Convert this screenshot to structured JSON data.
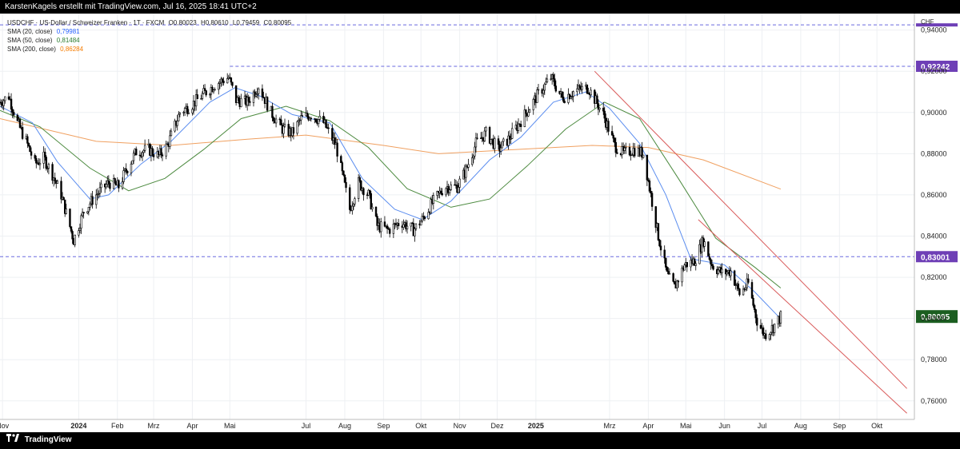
{
  "header": {
    "text": "KarstenKagels erstellt mit TradingView.com, Jul 16, 2025 18:41 UTC+2"
  },
  "footer": {
    "brand": "TradingView"
  },
  "legend": {
    "symbol_line": "USDCHF · US-Dollar / Schweizer Franken · 1T · FXCM",
    "ohlc": [
      "O0,80023",
      "H0,80610",
      "L0,79459",
      "C0,80095"
    ],
    "sma": [
      {
        "label": "SMA (20, close)",
        "value": "0,79981",
        "color": "#2962ff"
      },
      {
        "label": "SMA (50, close)",
        "value": "0,81484",
        "color": "#2e7d32"
      },
      {
        "label": "SMA (200, close)",
        "value": "0,86284",
        "color": "#f57c00"
      }
    ]
  },
  "colors": {
    "up": "#000000",
    "down": "#000000",
    "up_fill": "#ffffff",
    "sma20": "#5b8def",
    "sma50": "#4c8a3f",
    "sma200": "#f0a060",
    "trend": "#d95a5a",
    "hline": "#6a6adf",
    "label_purple": "#6e3fb6",
    "label_green": "#1b5e20"
  },
  "chart_data": {
    "type": "candlestick",
    "symbol": "USDCHF",
    "currency_label": "CHF",
    "ylim": [
      0.751,
      0.948
    ],
    "y_ticks": [
      "0,94000",
      "0,92000",
      "0,90000",
      "0,88000",
      "0,86000",
      "0,84000",
      "0,82000",
      "0,80000",
      "0,78000",
      "0,76000"
    ],
    "y_tick_values": [
      0.94,
      0.92,
      0.9,
      0.88,
      0.86,
      0.84,
      0.82,
      0.8,
      0.78,
      0.76
    ],
    "x_range": [
      "2023-10-30",
      "2025-10-31"
    ],
    "x_ticks": [
      {
        "label": "Nov",
        "date": "2023-11-01",
        "bold": false
      },
      {
        "label": "2024",
        "date": "2024-01-01",
        "bold": true
      },
      {
        "label": "Feb",
        "date": "2024-02-01",
        "bold": false
      },
      {
        "label": "Mrz",
        "date": "2024-03-01",
        "bold": false
      },
      {
        "label": "Apr",
        "date": "2024-04-01",
        "bold": false
      },
      {
        "label": "Mai",
        "date": "2024-05-01",
        "bold": false
      },
      {
        "label": "Jul",
        "date": "2024-07-01",
        "bold": false
      },
      {
        "label": "Aug",
        "date": "2024-08-01",
        "bold": false
      },
      {
        "label": "Sep",
        "date": "2024-09-01",
        "bold": false
      },
      {
        "label": "Okt",
        "date": "2024-10-01",
        "bold": false
      },
      {
        "label": "Nov",
        "date": "2024-11-01",
        "bold": false
      },
      {
        "label": "Dez",
        "date": "2024-12-01",
        "bold": false
      },
      {
        "label": "2025",
        "date": "2025-01-01",
        "bold": true
      },
      {
        "label": "Mrz",
        "date": "2025-03-01",
        "bold": false
      },
      {
        "label": "Apr",
        "date": "2025-04-01",
        "bold": false
      },
      {
        "label": "Mai",
        "date": "2025-05-01",
        "bold": false
      },
      {
        "label": "Jun",
        "date": "2025-06-01",
        "bold": false
      },
      {
        "label": "Jul",
        "date": "2025-07-01",
        "bold": false
      },
      {
        "label": "Aug",
        "date": "2025-08-01",
        "bold": false
      },
      {
        "label": "Sep",
        "date": "2025-09-01",
        "bold": false
      },
      {
        "label": "Okt",
        "date": "2025-10-01",
        "bold": false
      }
    ],
    "price_path": [
      [
        "2023-10-30",
        0.905
      ],
      [
        "2023-11-06",
        0.908
      ],
      [
        "2023-11-13",
        0.895
      ],
      [
        "2023-11-20",
        0.886
      ],
      [
        "2023-11-27",
        0.875
      ],
      [
        "2023-12-04",
        0.878
      ],
      [
        "2023-12-11",
        0.87
      ],
      [
        "2023-12-18",
        0.86
      ],
      [
        "2023-12-28",
        0.838
      ],
      [
        "2024-01-05",
        0.852
      ],
      [
        "2024-01-15",
        0.86
      ],
      [
        "2024-01-25",
        0.866
      ],
      [
        "2024-02-02",
        0.864
      ],
      [
        "2024-02-08",
        0.872
      ],
      [
        "2024-02-16",
        0.881
      ],
      [
        "2024-02-26",
        0.882
      ],
      [
        "2024-03-05",
        0.879
      ],
      [
        "2024-03-12",
        0.884
      ],
      [
        "2024-03-22",
        0.9
      ],
      [
        "2024-04-01",
        0.904
      ],
      [
        "2024-04-10",
        0.909
      ],
      [
        "2024-04-20",
        0.914
      ],
      [
        "2024-04-30",
        0.917
      ],
      [
        "2024-05-06",
        0.906
      ],
      [
        "2024-05-15",
        0.905
      ],
      [
        "2024-05-24",
        0.913
      ],
      [
        "2024-06-03",
        0.9
      ],
      [
        "2024-06-12",
        0.892
      ],
      [
        "2024-06-20",
        0.89
      ],
      [
        "2024-06-27",
        0.897
      ],
      [
        "2024-07-05",
        0.899
      ],
      [
        "2024-07-15",
        0.895
      ],
      [
        "2024-07-25",
        0.884
      ],
      [
        "2024-08-05",
        0.853
      ],
      [
        "2024-08-12",
        0.866
      ],
      [
        "2024-08-20",
        0.86
      ],
      [
        "2024-08-27",
        0.845
      ],
      [
        "2024-09-05",
        0.843
      ],
      [
        "2024-09-15",
        0.847
      ],
      [
        "2024-09-25",
        0.843
      ],
      [
        "2024-10-02",
        0.848
      ],
      [
        "2024-10-10",
        0.856
      ],
      [
        "2024-10-20",
        0.864
      ],
      [
        "2024-10-30",
        0.864
      ],
      [
        "2024-11-06",
        0.872
      ],
      [
        "2024-11-14",
        0.885
      ],
      [
        "2024-11-22",
        0.89
      ],
      [
        "2024-12-02",
        0.882
      ],
      [
        "2024-12-10",
        0.887
      ],
      [
        "2024-12-20",
        0.896
      ],
      [
        "2025-01-03",
        0.909
      ],
      [
        "2025-01-13",
        0.917
      ],
      [
        "2025-01-22",
        0.907
      ],
      [
        "2025-02-03",
        0.911
      ],
      [
        "2025-02-12",
        0.912
      ],
      [
        "2025-02-24",
        0.899
      ],
      [
        "2025-03-05",
        0.884
      ],
      [
        "2025-03-12",
        0.88
      ],
      [
        "2025-03-20",
        0.882
      ],
      [
        "2025-03-28",
        0.88
      ],
      [
        "2025-04-03",
        0.86
      ],
      [
        "2025-04-09",
        0.84
      ],
      [
        "2025-04-16",
        0.821
      ],
      [
        "2025-04-22",
        0.815
      ],
      [
        "2025-04-30",
        0.826
      ],
      [
        "2025-05-08",
        0.828
      ],
      [
        "2025-05-15",
        0.838
      ],
      [
        "2025-05-22",
        0.826
      ],
      [
        "2025-05-30",
        0.822
      ],
      [
        "2025-06-06",
        0.823
      ],
      [
        "2025-06-13",
        0.812
      ],
      [
        "2025-06-20",
        0.817
      ],
      [
        "2025-06-27",
        0.799
      ],
      [
        "2025-07-03",
        0.792
      ],
      [
        "2025-07-10",
        0.796
      ],
      [
        "2025-07-16",
        0.8009
      ]
    ],
    "sma20": [
      [
        "2023-10-30",
        0.903
      ],
      [
        "2023-11-25",
        0.895
      ],
      [
        "2023-12-15",
        0.876
      ],
      [
        "2024-01-10",
        0.858
      ],
      [
        "2024-01-25",
        0.86
      ],
      [
        "2024-02-20",
        0.875
      ],
      [
        "2024-03-15",
        0.886
      ],
      [
        "2024-04-15",
        0.905
      ],
      [
        "2024-05-05",
        0.912
      ],
      [
        "2024-05-25",
        0.908
      ],
      [
        "2024-06-20",
        0.899
      ],
      [
        "2024-07-20",
        0.895
      ],
      [
        "2024-08-15",
        0.868
      ],
      [
        "2024-09-10",
        0.853
      ],
      [
        "2024-10-02",
        0.848
      ],
      [
        "2024-10-25",
        0.857
      ],
      [
        "2024-11-25",
        0.877
      ],
      [
        "2024-12-20",
        0.888
      ],
      [
        "2025-01-15",
        0.905
      ],
      [
        "2025-02-10",
        0.91
      ],
      [
        "2025-03-01",
        0.902
      ],
      [
        "2025-03-25",
        0.885
      ],
      [
        "2025-04-15",
        0.86
      ],
      [
        "2025-05-05",
        0.829
      ],
      [
        "2025-06-01",
        0.826
      ],
      [
        "2025-06-25",
        0.813
      ],
      [
        "2025-07-16",
        0.7998
      ]
    ],
    "sma50": [
      [
        "2023-10-30",
        0.901
      ],
      [
        "2023-12-01",
        0.893
      ],
      [
        "2024-01-10",
        0.873
      ],
      [
        "2024-02-10",
        0.862
      ],
      [
        "2024-03-10",
        0.868
      ],
      [
        "2024-04-10",
        0.882
      ],
      [
        "2024-05-10",
        0.897
      ],
      [
        "2024-06-15",
        0.903
      ],
      [
        "2024-07-20",
        0.896
      ],
      [
        "2024-08-20",
        0.883
      ],
      [
        "2024-09-20",
        0.863
      ],
      [
        "2024-10-25",
        0.854
      ],
      [
        "2024-11-25",
        0.858
      ],
      [
        "2024-12-25",
        0.874
      ],
      [
        "2025-01-25",
        0.892
      ],
      [
        "2025-02-25",
        0.905
      ],
      [
        "2025-03-25",
        0.897
      ],
      [
        "2025-04-25",
        0.868
      ],
      [
        "2025-05-25",
        0.839
      ],
      [
        "2025-06-25",
        0.825
      ],
      [
        "2025-07-16",
        0.8148
      ]
    ],
    "sma200": [
      [
        "2023-10-30",
        0.897
      ],
      [
        "2024-01-15",
        0.886
      ],
      [
        "2024-03-15",
        0.884
      ],
      [
        "2024-05-15",
        0.887
      ],
      [
        "2024-07-01",
        0.889
      ],
      [
        "2024-09-01",
        0.884
      ],
      [
        "2024-10-15",
        0.88
      ],
      [
        "2024-12-15",
        0.882
      ],
      [
        "2025-02-15",
        0.884
      ],
      [
        "2025-04-01",
        0.883
      ],
      [
        "2025-05-15",
        0.877
      ],
      [
        "2025-07-16",
        0.8628
      ]
    ],
    "trend_lines": [
      {
        "from": [
          "2025-02-17",
          0.92
        ],
        "to": [
          "2025-10-25",
          0.766
        ]
      },
      {
        "from": [
          "2025-05-11",
          0.848
        ],
        "to": [
          "2025-10-25",
          0.754
        ]
      }
    ],
    "horizontal_lines": [
      {
        "y": 0.9425,
        "label": "",
        "x_from": "2023-10-30"
      },
      {
        "y": 0.92242,
        "label": "0,92242",
        "x_from": "2024-05-01"
      },
      {
        "y": 0.83001,
        "label": "0,83001",
        "x_from": "2023-10-30"
      }
    ],
    "last_price_label": {
      "y": 0.80095,
      "label": "0,80095"
    }
  }
}
